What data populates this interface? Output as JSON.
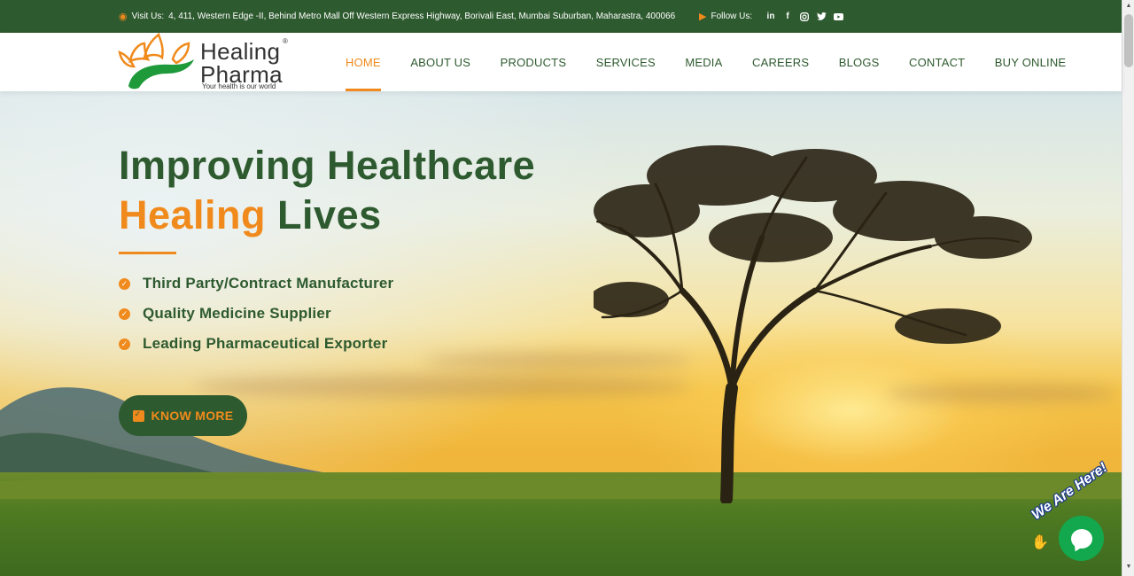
{
  "topbar": {
    "visit_label": "Visit Us:",
    "address": "4, 411, Western Edge -II, Behind Metro Mall Off Western Express Highway, Borivali East, Mumbai Suburban, Maharastra, 400066",
    "follow_label": "Follow Us:",
    "socials": [
      "linkedin-icon",
      "facebook-icon",
      "instagram-icon",
      "twitter-icon",
      "youtube-icon"
    ]
  },
  "logo": {
    "line1": "Healing",
    "line2": "Pharma",
    "reg": "®",
    "tagline": "Your health is our world"
  },
  "nav": {
    "items": [
      {
        "label": "HOME",
        "active": true
      },
      {
        "label": "ABOUT US"
      },
      {
        "label": "PRODUCTS"
      },
      {
        "label": "SERVICES"
      },
      {
        "label": "MEDIA"
      },
      {
        "label": "CAREERS"
      },
      {
        "label": "BLOGS"
      },
      {
        "label": "CONTACT"
      },
      {
        "label": "BUY ONLINE"
      }
    ]
  },
  "hero": {
    "title_line1": "Improving Healthcare",
    "title_highlight": "Healing",
    "title_rest": " Lives",
    "features": [
      "Third Party/Contract Manufacturer",
      "Quality Medicine Supplier",
      "Leading Pharmaceutical Exporter"
    ],
    "cta_label": "KNOW MORE"
  },
  "chat": {
    "badge": "We Are Here!"
  },
  "colors": {
    "brand_green": "#2e5a2f",
    "brand_orange": "#f08a1c",
    "chat_green": "#13a84d"
  }
}
